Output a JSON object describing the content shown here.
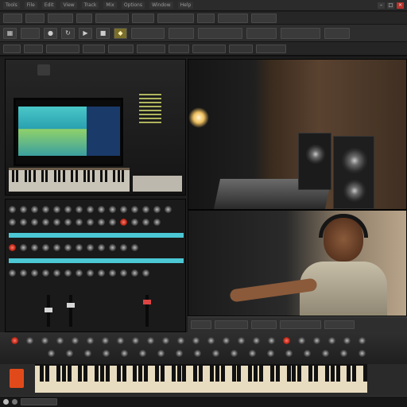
{
  "menubar": {
    "items": [
      "Tools",
      "File",
      "Edit",
      "View",
      "Track",
      "Mix",
      "Options",
      "Window",
      "Help"
    ]
  },
  "window_controls": {
    "minimize": "–",
    "maximize": "□",
    "close": "✕"
  },
  "toolbar": {
    "icons": [
      "grid-icon",
      "record-icon",
      "loop-icon",
      "play-icon",
      "stop-icon",
      "metronome-icon"
    ]
  },
  "colors": {
    "accent": "#4cc7d4",
    "highlight": "#7a6f2a",
    "danger": "#b5332b",
    "synth_orange": "#e04a1a"
  }
}
